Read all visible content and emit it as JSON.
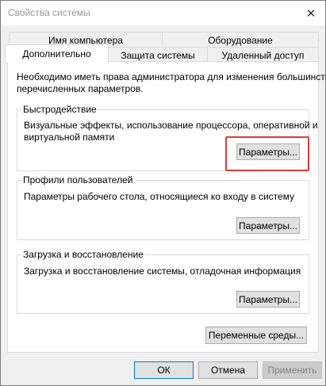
{
  "window": {
    "title": "Свойства системы",
    "close_glyph": "✕"
  },
  "tabs": {
    "row_top": [
      "Имя компьютера",
      "Оборудование"
    ],
    "row_bottom": [
      "Дополнительно",
      "Защита системы",
      "Удаленный доступ"
    ],
    "active": "Дополнительно"
  },
  "panel": {
    "admin_note_line1": "Необходимо иметь права администратора для изменения большинства",
    "admin_note_line2": "перечисленных параметров.",
    "performance": {
      "title": "Быстродействие",
      "desc_line1": "Визуальные эффекты, использование процессора, оперативной и",
      "desc_line2": "виртуальной памяти",
      "button_label": "Параметры..."
    },
    "profiles": {
      "title": "Профили пользователей",
      "desc": "Параметры рабочего стола, относящиеся ко входу в систему",
      "button_label": "Параметры..."
    },
    "startup": {
      "title": "Загрузка и восстановление",
      "desc": "Загрузка и восстановление системы, отладочная информация",
      "button_label": "Параметры..."
    },
    "env_button_label": "Переменные среды..."
  },
  "footer": {
    "ok_label": "ОК",
    "cancel_label": "Отмена",
    "apply_label": "Применить"
  },
  "colors": {
    "highlight": "#e0393a",
    "default_button_border": "#0078d7"
  }
}
